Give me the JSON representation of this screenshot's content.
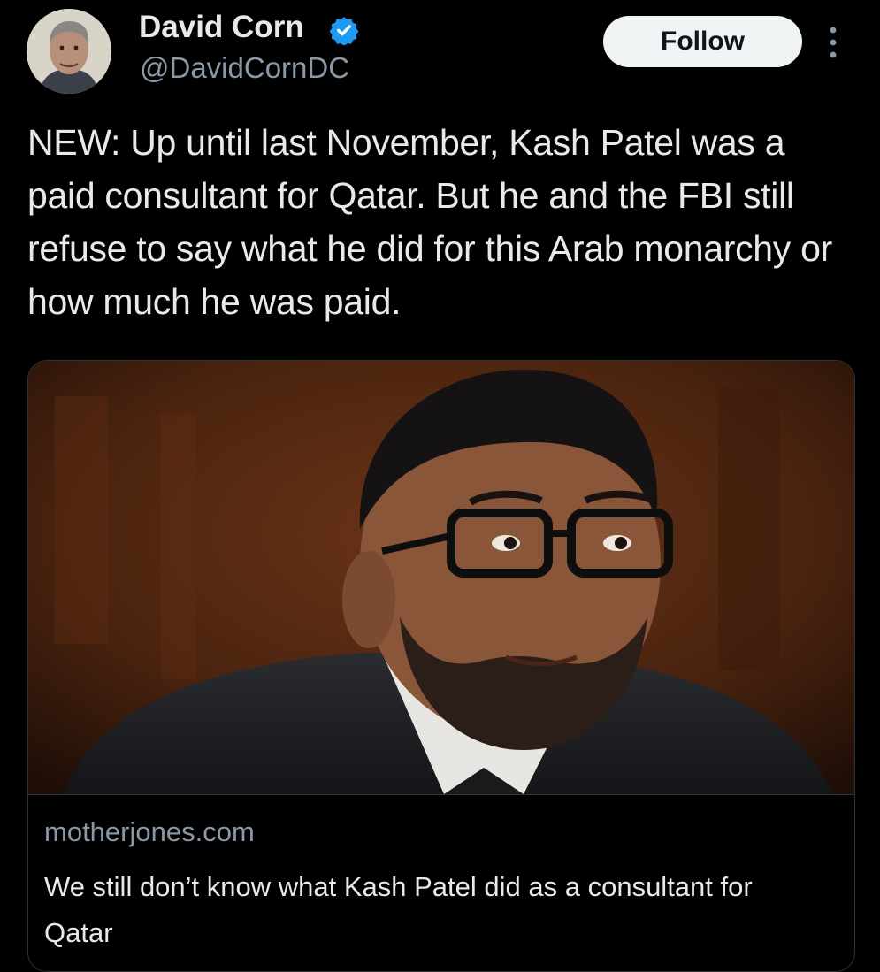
{
  "author": {
    "display_name": "David Corn",
    "handle": "@DavidCornDC",
    "verified": true,
    "verified_color": "#1d9bf0"
  },
  "actions": {
    "follow_label": "Follow",
    "more_icon": "more-vertical-icon"
  },
  "tweet": {
    "text": "NEW: Up until last November, Kash Patel was a paid consultant for Qatar. But he and the FBI still refuse to say what he did for this Arab monarchy or how much he was paid."
  },
  "link_card": {
    "domain": "motherjones.com",
    "title": "We still don’t know what Kash Patel did as a consultant for Qatar"
  },
  "colors": {
    "background": "#000000",
    "text_primary": "#e7e9ea",
    "text_secondary": "#8b98a5",
    "follow_bg": "#eff3f4",
    "border": "#2f3336"
  }
}
